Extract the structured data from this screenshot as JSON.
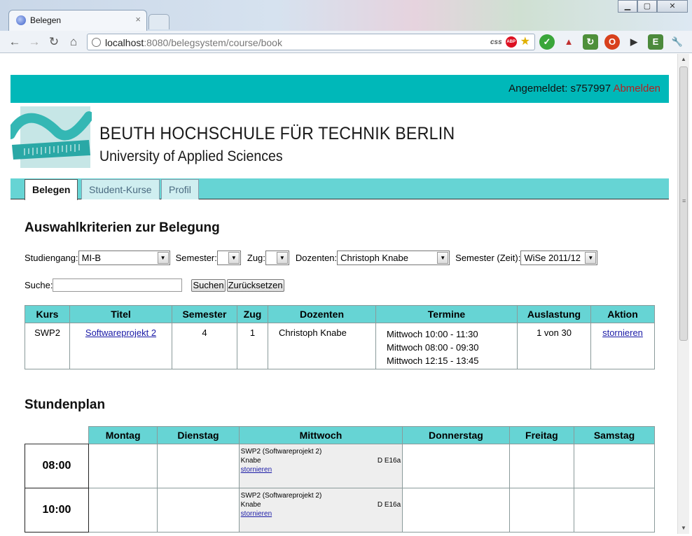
{
  "browser": {
    "tab_title": "Belegen",
    "tab_close": "×",
    "url_host": "localhost",
    "url_rest": ":8080/belegsystem/course/book",
    "css_badge": "css",
    "abp_badge": "ABP",
    "window_controls": [
      "▁",
      "▢",
      "✕"
    ]
  },
  "topbar": {
    "logged_in_label": "Angemeldet: s757997",
    "logout": "Abmelden"
  },
  "header": {
    "school_name": "BEUTH HOCHSCHULE FÜR TECHNIK BERLIN",
    "school_sub": "University of Applied Sciences"
  },
  "nav": {
    "tabs": [
      "Belegen",
      "Student-Kurse",
      "Profil"
    ]
  },
  "filters": {
    "title": "Auswahlkriterien zur Belegung",
    "studiengang_label": "Studiengang:",
    "studiengang_value": "MI-B",
    "semester_label": "Semester:",
    "semester_value": "",
    "zug_label": "Zug:",
    "zug_value": "",
    "dozenten_label": "Dozenten:",
    "dozenten_value": "Christoph Knabe",
    "semester_zeit_label": "Semester (Zeit):",
    "semester_zeit_value": "WiSe 2011/12",
    "search_label": "Suche:",
    "search_value": "",
    "search_button": "Suchen",
    "reset_button": "Zurücksetzen"
  },
  "courses": {
    "headers": [
      "Kurs",
      "Titel",
      "Semester",
      "Zug",
      "Dozenten",
      "Termine",
      "Auslastung",
      "Aktion"
    ],
    "rows": [
      {
        "kurs": "SWP2",
        "titel": "Softwareprojekt 2",
        "semester": "4",
        "zug": "1",
        "dozenten": "Christoph Knabe",
        "termine": [
          "Mittwoch 10:00 - 11:30",
          "Mittwoch 08:00 - 09:30",
          "Mittwoch 12:15 - 13:45"
        ],
        "auslastung": "1 von 30",
        "aktion": "stornieren"
      }
    ]
  },
  "plan": {
    "title": "Stundenplan",
    "days": [
      "Montag",
      "Dienstag",
      "Mittwoch",
      "Donnerstag",
      "Freitag",
      "Samstag"
    ],
    "slots": [
      {
        "time": "08:00",
        "entry": {
          "course": "SWP2 (Softwareprojekt 2)",
          "teacher": "Knabe",
          "room": "D E16a",
          "action": "stornieren"
        }
      },
      {
        "time": "10:00",
        "entry": {
          "course": "SWP2 (Softwareprojekt 2)",
          "teacher": "Knabe",
          "room": "D E16a",
          "action": "stornieren"
        }
      }
    ]
  },
  "colors": {
    "topbar": "#00b8b9",
    "nav": "#66d4d4",
    "table_header": "#66d4d4",
    "logout": "#b22222"
  }
}
